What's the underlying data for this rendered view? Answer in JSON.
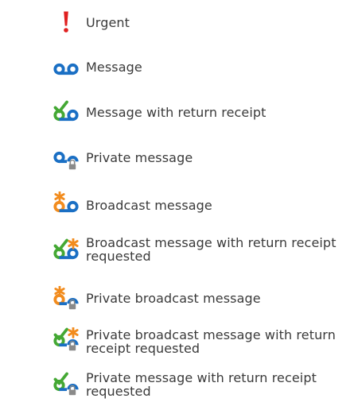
{
  "colors": {
    "blue": "#1a6fc4",
    "green": "#44a834",
    "orange": "#f28c1e",
    "red": "#e02020",
    "lock": "#8a8a8a",
    "text": "#3a3a3a"
  },
  "legend": {
    "items": [
      {
        "icon": "urgent-icon",
        "label": "Urgent"
      },
      {
        "icon": "message-icon",
        "label": "Message"
      },
      {
        "icon": "message-return-receipt-icon",
        "label": "Message with return receipt"
      },
      {
        "icon": "private-message-icon",
        "label": "Private message"
      },
      {
        "icon": "broadcast-message-icon",
        "label": "Broadcast message"
      },
      {
        "icon": "broadcast-return-receipt-icon",
        "label": "Broadcast message with return receipt requested"
      },
      {
        "icon": "private-broadcast-icon",
        "label": "Private broadcast message"
      },
      {
        "icon": "private-broadcast-return-receipt-icon",
        "label": "Private broadcast message with return receipt requested"
      },
      {
        "icon": "private-return-receipt-icon",
        "label": "Private message with return receipt requested"
      }
    ]
  }
}
